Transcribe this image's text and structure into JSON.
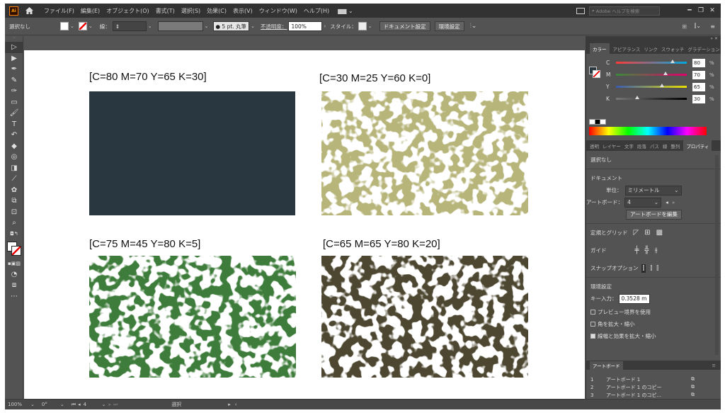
{
  "menubar": {
    "logo": "Ai",
    "menus": [
      "ファイル(F)",
      "編集(E)",
      "オブジェクト(O)",
      "書式(T)",
      "選択(S)",
      "効果(C)",
      "表示(V)",
      "ウィンドウ(W)",
      "ヘルプ(H)"
    ],
    "workspace": "▆▆ ⌄",
    "search_placeholder": "Adobe ヘルプを検索",
    "window_buttons": [
      "━",
      "❐",
      "✕"
    ]
  },
  "controlbar": {
    "selection": "選択なし",
    "stroke_label": "線：",
    "brush": "●  5 pt. 丸筆",
    "opacity_label": "不透明度：",
    "opacity_value": "100%",
    "style_label": "スタイル：",
    "doc_setup": "ドキュメント設定",
    "prefs": "環境設定"
  },
  "swatches": [
    {
      "label": "[C=80 M=70 Y=65 K=30]",
      "color": "#283740",
      "pattern": "solid"
    },
    {
      "label": "[C=30 M=25 Y=60 K=0]",
      "color": "#b7b57a",
      "pattern": "noise"
    },
    {
      "label": "[C=75 M=45 Y=80 K=5]",
      "color": "#3e7c3a",
      "pattern": "noise"
    },
    {
      "label": "[C=65 M=65 Y=80 K=20]",
      "color": "#4d4730",
      "pattern": "noise"
    }
  ],
  "color_panel": {
    "tabs": [
      "カラー",
      "アピアランス",
      "リンク",
      "スウォッチ",
      "グラデーション"
    ],
    "channels": [
      {
        "name": "C",
        "value": "80",
        "fraction": 0.8,
        "grad_start": "#ff3a3a",
        "grad_end": "#00a8e0"
      },
      {
        "name": "M",
        "value": "70",
        "fraction": 0.7,
        "grad_start": "#3a8a3a",
        "grad_end": "#e0006a"
      },
      {
        "name": "Y",
        "value": "65",
        "fraction": 0.65,
        "grad_start": "#3a5ab0",
        "grad_end": "#e8e000"
      },
      {
        "name": "K",
        "value": "30",
        "fraction": 0.3,
        "grad_start": "#777777",
        "grad_end": "#000000"
      }
    ],
    "unit": "%"
  },
  "properties_panel": {
    "tabs": [
      "透明",
      "レイヤー",
      "文字",
      "段落",
      "パス",
      "線",
      "整列",
      "プロパティ"
    ],
    "no_selection": "選択なし",
    "document_heading": "ドキュメント",
    "unit_label": "単位：",
    "unit_value": "ミリメートル",
    "artboard_label": "アートボード：",
    "artboard_value": "4",
    "edit_artboards": "アートボードを編集",
    "rulers_grids": "定規とグリッド",
    "guides": "ガイド",
    "snap_options": "スナップオプション",
    "preferences_heading": "環境設定",
    "key_increment_label": "キー入力：",
    "key_increment_value": "0.3528 m",
    "checkboxes": [
      {
        "label": "プレビュー境界を使用",
        "checked": false
      },
      {
        "label": "角を拡大・縮小",
        "checked": false
      },
      {
        "label": "線幅と効果を拡大・縮小",
        "checked": true
      }
    ]
  },
  "artboards_panel": {
    "title": "アートボード",
    "rows": [
      {
        "n": "1",
        "name": "アートボード 1"
      },
      {
        "n": "2",
        "name": "アートボード 1 のコピー"
      },
      {
        "n": "3",
        "name": "アートボード 1 のコピ..."
      },
      {
        "n": "4",
        "name": "アートボード 1 のコピ..."
      }
    ]
  },
  "statusbar": {
    "zoom": "100%",
    "rotation": "0°",
    "artboard": "4",
    "mode": "選択"
  }
}
